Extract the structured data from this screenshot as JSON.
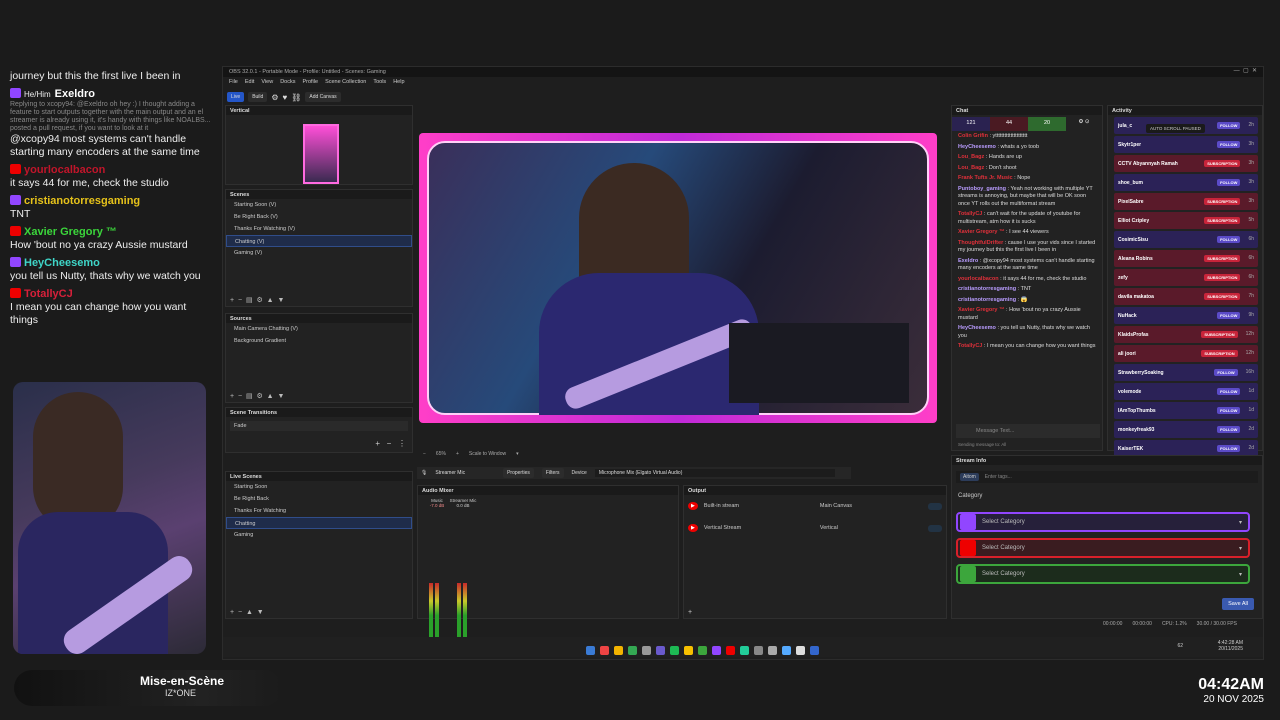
{
  "overlay_chat": [
    {
      "text": "journey but this the first live I been in"
    },
    {
      "name": "Exeldro",
      "pronoun": "He/Him",
      "color": "#ffffff",
      "badge": "tw",
      "reply": "Replying to xcopy94: @Exeldro oh hey :) I thought adding a feature to start outputs together with the main output and an el streamer is already using it, it's handy with things like NOALBS... posted a pull request, if you want to look at it",
      "text": "@xcopy94 most systems can't handle starting many encoders at the same time"
    },
    {
      "name": "yourlocalbacon",
      "color": "#c0152a",
      "badge": "yt",
      "text": "it says 44 for me, check the studio"
    },
    {
      "name": "cristianotorresgaming",
      "color": "#e6c21a",
      "badge": "tw",
      "text": "TNT"
    },
    {
      "name": "Xavier Gregory ™",
      "color": "#3bd63b",
      "badge": "yt",
      "text": "How 'bout no ya crazy Aussie mustard"
    },
    {
      "name": "HeyCheesemo",
      "color": "#3fd6c8",
      "badge": "tw",
      "text": "you tell us Nutty, thats why we watch you"
    },
    {
      "name": "TotallyCJ",
      "color": "#d6203a",
      "badge": "yt",
      "text": "I mean you can change how you want things"
    }
  ],
  "now_playing": {
    "title": "Mise-en-Scène",
    "artist": "IZ*ONE"
  },
  "clock": {
    "time": "04:42AM",
    "date": "20 NOV 2025"
  },
  "obs": {
    "title": "OBS 32.0.1 - Portable Mode - Profile: Untitled - Scenes: Gaming",
    "menu": [
      "File",
      "Edit",
      "View",
      "Docks",
      "Profile",
      "Scene Collection",
      "Tools",
      "Help"
    ],
    "mode_buttons": [
      "Live",
      "Build"
    ],
    "add_canvas": "Add Canvas",
    "vertical_label": "Vertical",
    "scenes_label": "Scenes",
    "scenes": [
      "Starting Soon (V)",
      "Be Right Back (V)",
      "Thanks For Watching (V)",
      "Chatting (V)",
      "Gaming (V)"
    ],
    "sources_label": "Sources",
    "sources": [
      "Main Camera Chatting (V)",
      "Background Gradient"
    ],
    "transitions_label": "Scene Transitions",
    "transition": "Fade",
    "live_scenes_label": "Live Scenes",
    "live_scenes": [
      "Starting Soon",
      "Be Right Back",
      "Thanks For Watching",
      "Chatting",
      "Gaming"
    ],
    "zoom": "65%",
    "scale": "Scale to Window",
    "source_bar": {
      "name": "Streamer Mic",
      "properties": "Properties",
      "filters": "Filters",
      "device_label": "Device",
      "device": "Microphone Mix (Elgato Virtual Audio)"
    },
    "mixer": {
      "label": "Audio Mixer",
      "channels": [
        {
          "name": "Music",
          "db": "-7.0 dB"
        },
        {
          "name": "Streamer Mic",
          "db": "0.0 dB"
        }
      ]
    },
    "output": {
      "label": "Output",
      "rows": [
        {
          "name": "Built-in stream",
          "canvas": "Main Canvas"
        },
        {
          "name": "Vertical Stream",
          "canvas": "Vertical"
        }
      ]
    },
    "status": {
      "time1": "00:00:00",
      "time2": "00:00:00",
      "cpu": "CPU: 1.2%",
      "fps": "30.00 / 30.00 FPS"
    }
  },
  "chat": {
    "label": "Chat",
    "counts": [
      "121",
      "44",
      "20"
    ],
    "messages": [
      {
        "name": "Colin Grifin",
        "text": "yttttttttttttttttttttt"
      },
      {
        "name": "HeyCheesemo",
        "text": "whats a yo toob"
      },
      {
        "name": "Lou_Bagz",
        "text": "Hands are up"
      },
      {
        "name": "Lou_Bagz",
        "text": "Don't shoot"
      },
      {
        "name": "Frank Tufts Jr. Music",
        "text": "Nope"
      },
      {
        "name": "Puntoboy_gaming",
        "text": "Yeah not working with multiple YT streams is annoying, but maybe that will be OK soon once YT rolls out the multiformat stream"
      },
      {
        "name": "TotallyCJ",
        "text": "can't wait for the update of youtube for multistream, atm how it is sucks"
      },
      {
        "name": "Xavier Gregory ™",
        "text": "I see 44 viewers"
      },
      {
        "name": "ThoughtfulDrifter",
        "text": "cause I use your vids since I started my journey but this the first live I been in"
      },
      {
        "name": "Exeldro",
        "text": "@xcopy94 most systems can't handle starting many encoders at the same time"
      },
      {
        "name": "yourlocalbacon",
        "text": "it says 44 for me, check the studio"
      },
      {
        "name": "cristianotorresgaming",
        "text": "TNT"
      },
      {
        "name": "cristianotorresgaming",
        "text": "😱"
      },
      {
        "name": "Xavier Gregory ™",
        "text": "How 'bout no ya crazy Aussie mustard"
      },
      {
        "name": "HeyCheesemo",
        "text": "you tell us Nutty, thats why we watch you"
      },
      {
        "name": "TotallyCJ",
        "text": "I mean you can change how you want things"
      }
    ],
    "placeholder": "Message Text...",
    "sending_to": "Sending message to: All"
  },
  "activity": {
    "label": "Activity",
    "paused": "AUTO SCROLL PAUSED",
    "items": [
      {
        "name": "jula_c",
        "tag": "FOLLOW",
        "age": "2h"
      },
      {
        "name": "Skytr1per",
        "tag": "FOLLOW",
        "age": "3h"
      },
      {
        "name": "CCTV Abyannyah Ramah",
        "tag": "SUBSCRIPTION",
        "age": "3h"
      },
      {
        "name": "shoe_bum",
        "tag": "FOLLOW",
        "age": "3h"
      },
      {
        "name": "PixelSabre",
        "tag": "SUBSCRIPTION",
        "age": "3h"
      },
      {
        "name": "Elliot Czipley",
        "tag": "SUBSCRIPTION",
        "age": "5h"
      },
      {
        "name": "CosimicSisu",
        "tag": "FOLLOW",
        "age": "6h"
      },
      {
        "name": "Aleana Robins",
        "tag": "SUBSCRIPTION",
        "age": "6h"
      },
      {
        "name": "zefy",
        "tag": "SUBSCRIPTION",
        "age": "6h"
      },
      {
        "name": "davila makatoa",
        "tag": "SUBSCRIPTION",
        "age": "7h"
      },
      {
        "name": "NuHack",
        "tag": "FOLLOW",
        "age": "9h"
      },
      {
        "name": "KlaidsProfas",
        "tag": "SUBSCRIPTION",
        "age": "12h"
      },
      {
        "name": "ali joori",
        "tag": "SUBSCRIPTION",
        "age": "12h"
      },
      {
        "name": "StrawberrySoaking",
        "tag": "FOLLOW",
        "age": "16h"
      },
      {
        "name": "volemode",
        "tag": "FOLLOW",
        "age": "1d"
      },
      {
        "name": "IAmTopThumbs",
        "tag": "FOLLOW",
        "age": "1d"
      },
      {
        "name": "monkeyfreak93",
        "tag": "FOLLOW",
        "age": "2d"
      },
      {
        "name": "KaiserTEK",
        "tag": "FOLLOW",
        "age": "2d"
      }
    ]
  },
  "stream_info": {
    "label": "Stream Info",
    "tag": "Aitom",
    "tag_placeholder": "Enter tags...",
    "category_label": "Category",
    "select": "Select Category",
    "save": "Save All"
  },
  "taskbar": {
    "time": "4:42:28 AM",
    "date": "20/11/2025",
    "badge": "62"
  }
}
